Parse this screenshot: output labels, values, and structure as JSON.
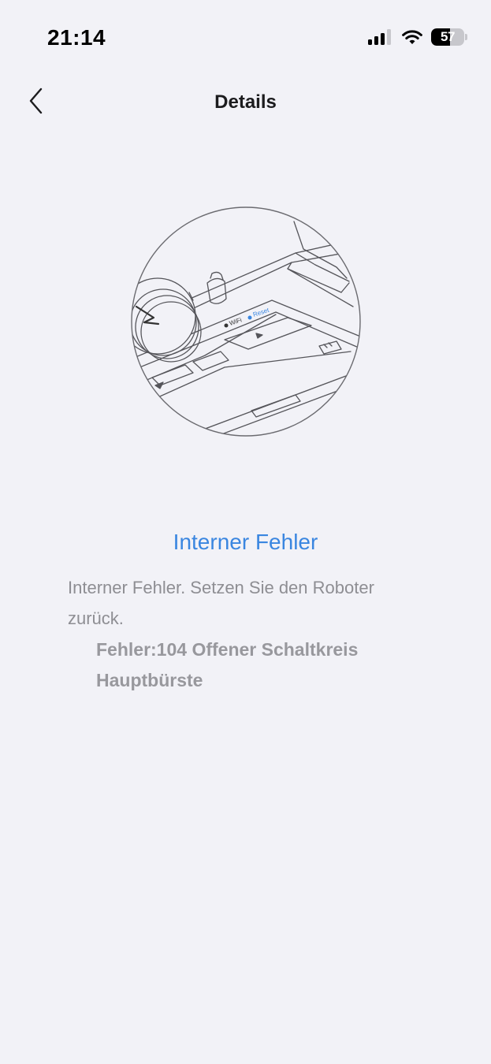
{
  "status_bar": {
    "time": "21:14",
    "battery_percent": 57,
    "battery_label": "57",
    "icons": [
      "signal-icon",
      "wifi-icon",
      "battery-icon"
    ]
  },
  "nav": {
    "title": "Details",
    "back_icon": "chevron-left-icon"
  },
  "illustration": {
    "wifi_label": "WiFi",
    "reset_label": "Reset"
  },
  "error": {
    "title": "Interner Fehler",
    "description": "Interner Fehler. Setzen Sie den Roboter zurück.",
    "code": "Fehler:104 Offener Schaltkreis Hauptbürste"
  },
  "colors": {
    "background": "#f2f2f7",
    "accent": "#3a86e0",
    "secondary_text": "#8e8e93",
    "reset_dot": "#3a86e0"
  }
}
